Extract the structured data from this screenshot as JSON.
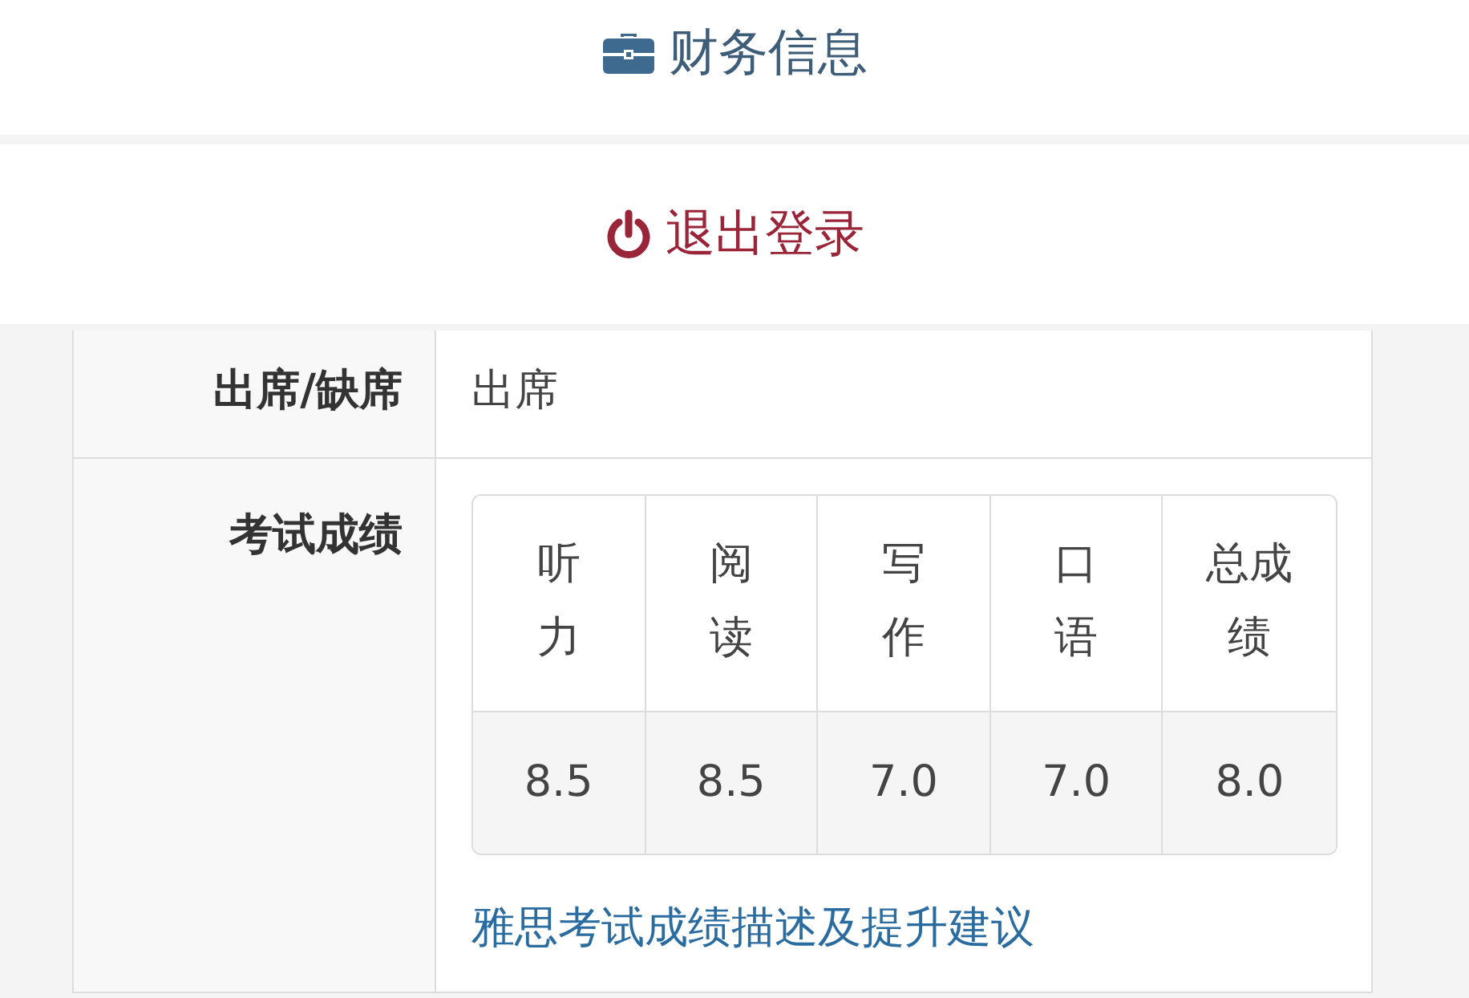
{
  "menu_items": [
    {
      "label": "财务信息",
      "kind": "finance"
    },
    {
      "label": "退出登录",
      "kind": "logout"
    }
  ],
  "details": [
    {
      "label": "出席/缺席",
      "value": "出席"
    },
    {
      "label": "考试成绩",
      "scores": {
        "columns": [
          "听力",
          "阅读",
          "写作",
          "口语",
          "总成绩"
        ],
        "values": [
          "8.5",
          "8.5",
          "7.0",
          "7.0",
          "8.0"
        ]
      },
      "link": "雅思考试成绩描述及提升建议"
    }
  ]
}
